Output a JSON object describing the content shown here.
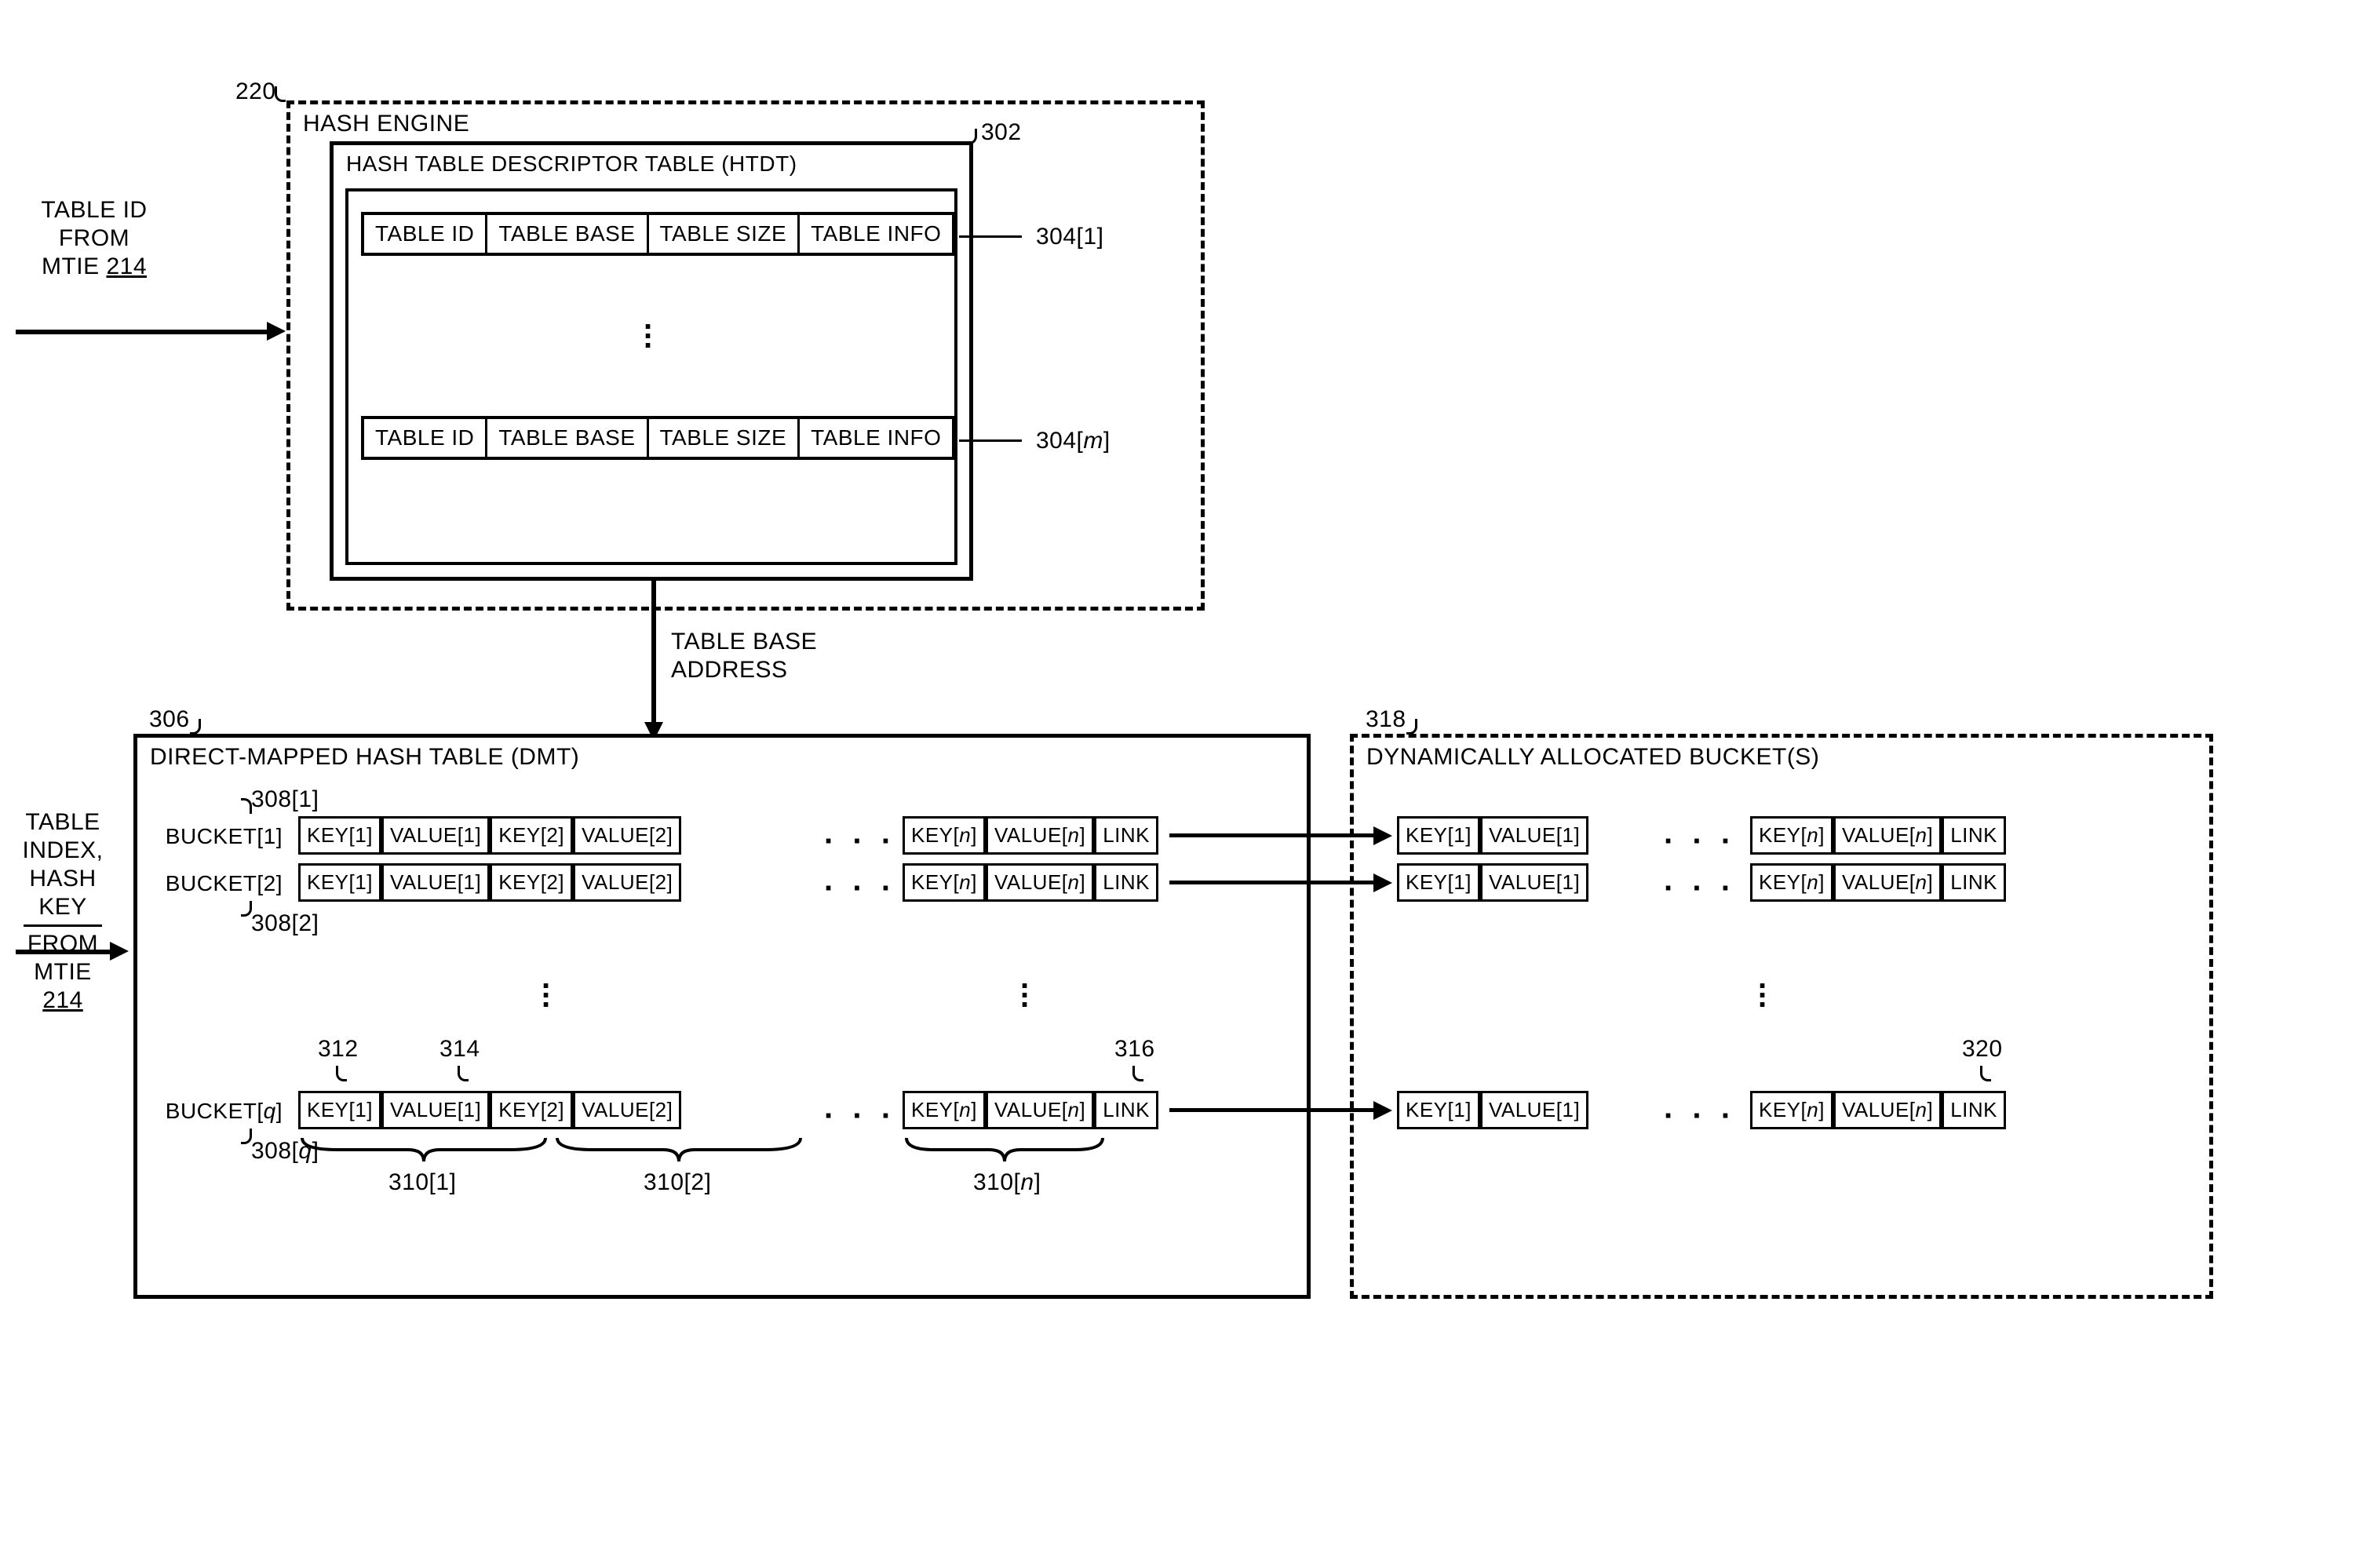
{
  "refs": {
    "hash_engine": "220",
    "htdt": "302",
    "htdt_row_first": "304[1]",
    "htdt_row_last": "304[m]",
    "dmt": "306",
    "bucket_first": "308[1]",
    "bucket_second": "308[2]",
    "bucket_last": "308[q]",
    "kv_first": "310[1]",
    "kv_second": "310[2]",
    "kv_last": "310[n]",
    "key_ptr": "312",
    "value_ptr": "314",
    "link_ptr": "316",
    "dyn_buckets": "318",
    "dyn_link_ptr": "320",
    "mtie": "214"
  },
  "titles": {
    "hash_engine": "HASH ENGINE",
    "htdt": "HASH TABLE DESCRIPTOR TABLE (HTDT)",
    "dmt": "DIRECT-MAPPED HASH TABLE (DMT)",
    "dyn": "DYNAMICALLY ALLOCATED BUCKET(S)"
  },
  "htdt_fields": [
    "TABLE ID",
    "TABLE BASE",
    "TABLE SIZE",
    "TABLE INFO"
  ],
  "arrows": {
    "table_base_address": "TABLE BASE\nADDRESS"
  },
  "inputs": {
    "table_id": "TABLE ID\nFROM\nMTIE",
    "table_index": "TABLE\nINDEX,\nHASH\nKEY\nFROM\nMTIE"
  },
  "buckets": {
    "b1": "BUCKET[1]",
    "b2": "BUCKET[2]",
    "bq": "BUCKET[q]"
  },
  "kv": {
    "k1": "KEY[1]",
    "v1": "VALUE[1]",
    "k2": "KEY[2]",
    "v2": "VALUE[2]",
    "kn": "KEY[n]",
    "vn": "VALUE[n]",
    "link": "LINK"
  },
  "math": {
    "m": "m",
    "n": "n",
    "q": "q"
  }
}
